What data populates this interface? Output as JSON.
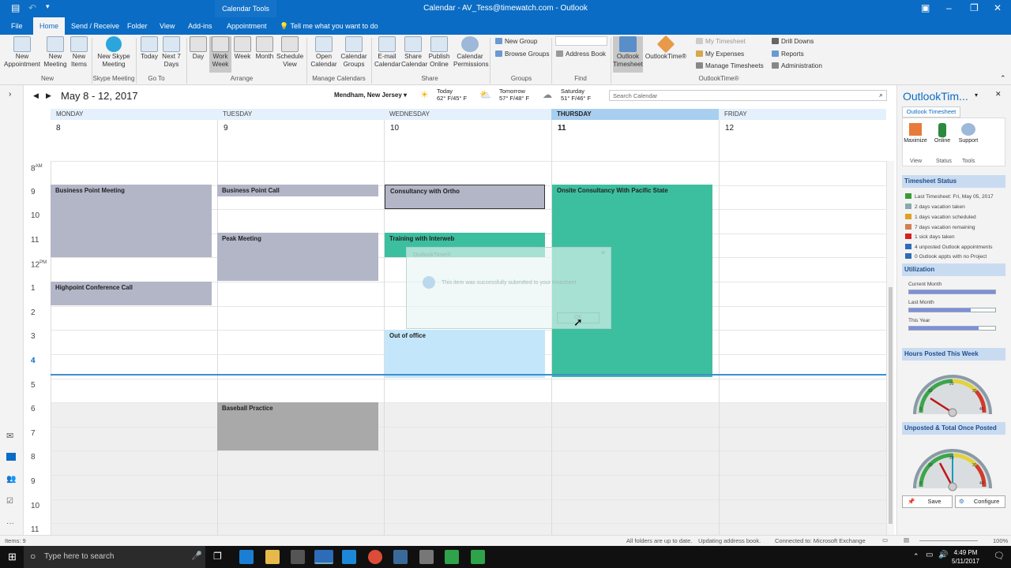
{
  "titlebar": {
    "contextual_group": "Calendar Tools",
    "title": "Calendar - AV_Tess@timewatch.com - Outlook"
  },
  "tabs": [
    "File",
    "Home",
    "Send / Receive",
    "Folder",
    "View",
    "Add-ins",
    "Appointment",
    "Tell me what you want to do"
  ],
  "ribbon": {
    "new_appointment": "New Appointment",
    "new_meeting": "New Meeting",
    "new_items": "New Items",
    "new_skype_meeting": "New Skype Meeting",
    "today": "Today",
    "next7": "Next 7 Days",
    "day": "Day",
    "work_week": "Work Week",
    "week": "Week",
    "month": "Month",
    "schedule_view": "Schedule View",
    "open_calendar": "Open Calendar",
    "calendar_groups": "Calendar Groups",
    "email_calendar": "E-mail Calendar",
    "share_calendar": "Share Calendar",
    "publish_online": "Publish Online",
    "calendar_permissions": "Calendar Permissions",
    "new_group": "New Group",
    "browse_groups": "Browse Groups",
    "address_book": "Address Book",
    "outlook_timesheet": "Outlook Timesheet",
    "outlooktime": "OutlookTime®",
    "my_timesheet": "My Timesheet",
    "my_expenses": "My Expenses",
    "manage_timesheets": "Manage Timesheets",
    "drill_downs": "Drill Downs",
    "reports": "Reports",
    "administration": "Administration",
    "groups": [
      "New",
      "Skype Meeting",
      "Go To",
      "Arrange",
      "Manage Calendars",
      "Share",
      "Groups",
      "Find",
      "OutlookTime®"
    ]
  },
  "calendar": {
    "range": "May 8 - 12, 2017",
    "location": "Mendham, New Jersey",
    "weather": [
      {
        "label": "Today",
        "temp": "62° F/45° F"
      },
      {
        "label": "Tomorrow",
        "temp": "57° F/48° F"
      },
      {
        "label": "Saturday",
        "temp": "51° F/46° F"
      }
    ],
    "search_placeholder": "Search Calendar",
    "days": [
      "MONDAY",
      "TUESDAY",
      "WEDNESDAY",
      "THURSDAY",
      "FRIDAY"
    ],
    "dates": [
      "8",
      "9",
      "10",
      "11",
      "12"
    ],
    "hours": [
      "8",
      "9",
      "10",
      "11",
      "12",
      "1",
      "2",
      "3",
      "4",
      "5",
      "6",
      "7",
      "8",
      "9",
      "10",
      "11"
    ],
    "am": "AM",
    "pm": "PM",
    "events": {
      "e1": "Business Point Meeting",
      "e2": "Business Point Call",
      "e3": "Consultancy with Ortho",
      "e4": "Onsite Consultancy With Pacific State",
      "e5": "Peak Meeting",
      "e6": "Training with Interweb",
      "e7": "Highpoint Conference Call",
      "e8": "Out of office",
      "e9": "Baseball Practice"
    }
  },
  "dialog": {
    "title": "OutlookTime®",
    "message": "This item was successfully submitted to your timesheet",
    "ok": "OK"
  },
  "rpane": {
    "title": "OutlookTim...",
    "tab": "Outlook Timesheet",
    "buttons": [
      "Maximize",
      "Online",
      "Support"
    ],
    "groups": [
      "View",
      "Status",
      "Tools"
    ],
    "status_header": "Timesheet Status",
    "status_items": [
      "Last Timesheet: Fri, May 05, 2017",
      "2 days vacation taken",
      "1 days vacation scheduled",
      "7 days vacation remaining",
      "1 sick days taken",
      "4 unposted Outlook appointments",
      "0 Outlook appts with no Project"
    ],
    "util_header": "Utilization",
    "util": [
      {
        "label": "Current Month",
        "value": 1.0
      },
      {
        "label": "Last Month",
        "value": 0.72
      },
      {
        "label": "This Year",
        "value": 0.81
      }
    ],
    "hours_header": "Hours Posted This Week",
    "unposted_header": "Unposted & Total Once Posted",
    "gauge_ticks": [
      "0",
      "10",
      "20",
      "30",
      "40"
    ],
    "save": "Save",
    "configure": "Configure"
  },
  "status": {
    "items": "Items: 9",
    "sync": "All folders are up to date.",
    "update": "Updating address book.",
    "connected": "Connected to: Microsoft Exchange",
    "zoom": "100%"
  },
  "taskbar": {
    "search": "Type here to search",
    "time": "4:49 PM",
    "date": "5/11/2017"
  }
}
